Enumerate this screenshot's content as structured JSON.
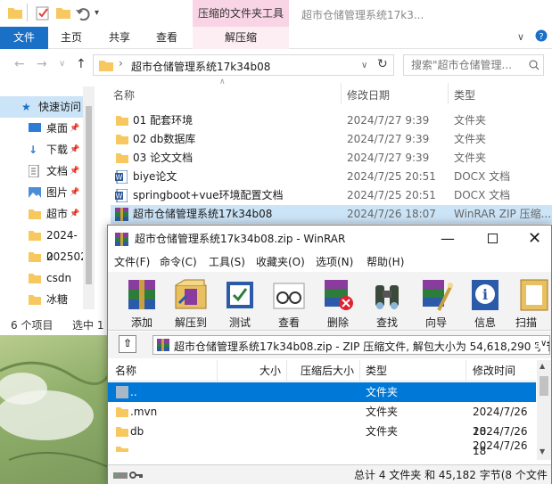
{
  "explorer": {
    "window_title": "超市仓储管理系统17k3...",
    "context_tab": "压缩的文件夹工具",
    "ribbon_tabs": [
      "文件",
      "主页",
      "共享",
      "查看",
      "解压缩"
    ],
    "breadcrumb": "超市仓储管理系统17k34b08",
    "search_placeholder": "搜索\"超市仓储管理...",
    "nav_items": [
      "快速访问",
      "桌面",
      "下载",
      "文档",
      "图片",
      "超市",
      "2024-0",
      "202502",
      "csdn",
      "冰糖"
    ],
    "columns": {
      "name": "名称",
      "date": "修改日期",
      "type": "类型"
    },
    "files": [
      {
        "name": "01 配套环境",
        "date": "2024/7/27 9:39",
        "type": "文件夹",
        "icon": "folder-icon"
      },
      {
        "name": "02 db数据库",
        "date": "2024/7/27 9:39",
        "type": "文件夹",
        "icon": "folder-icon"
      },
      {
        "name": "03 论文文档",
        "date": "2024/7/27 9:39",
        "type": "文件夹",
        "icon": "folder-icon"
      },
      {
        "name": "biye论文",
        "date": "2024/7/25 20:51",
        "type": "DOCX 文档",
        "icon": "word-doc-icon"
      },
      {
        "name": "springboot+vue环境配置文档",
        "date": "2024/7/25 20:51",
        "type": "DOCX 文档",
        "icon": "word-doc-icon"
      },
      {
        "name": "超市仓储管理系统17k34b08",
        "date": "2024/7/26 18:07",
        "type": "WinRAR ZIP 压缩...",
        "icon": "winrar-archive-icon"
      }
    ],
    "status": {
      "count": "6 个项目",
      "selected": "选中 1"
    }
  },
  "winrar": {
    "title": "超市仓储管理系统17k34b08.zip - WinRAR",
    "menu": [
      "文件(F)",
      "命令(C)",
      "工具(S)",
      "收藏夹(O)",
      "选项(N)",
      "帮助(H)"
    ],
    "toolbar": [
      "添加",
      "解压到",
      "测试",
      "查看",
      "删除",
      "查找",
      "向导",
      "信息",
      "扫描"
    ],
    "path_text": "超市仓储管理系统17k34b08.zip - ZIP 压缩文件, 解包大小为 54,618,290 字节",
    "columns": {
      "name": "名称",
      "size": "大小",
      "packed": "压缩后大小",
      "type": "类型",
      "modified": "修改时间"
    },
    "rows": [
      {
        "name": "..",
        "type": "文件夹",
        "modified": ""
      },
      {
        "name": ".mvn",
        "type": "文件夹",
        "modified": "2024/7/26 18"
      },
      {
        "name": "db",
        "type": "文件夹",
        "modified": "2024/7/26 18"
      },
      {
        "name": "",
        "type": "",
        "modified": "2024/7/26 18"
      }
    ],
    "status": "总计 4 文件夹 和 45,182 字节(8 个文件"
  },
  "colors": {
    "accent": "#0078d7",
    "file_tab": "#1a6fc7",
    "ctx_tab": "#f9d4e4",
    "folder": "#f6c85f"
  }
}
